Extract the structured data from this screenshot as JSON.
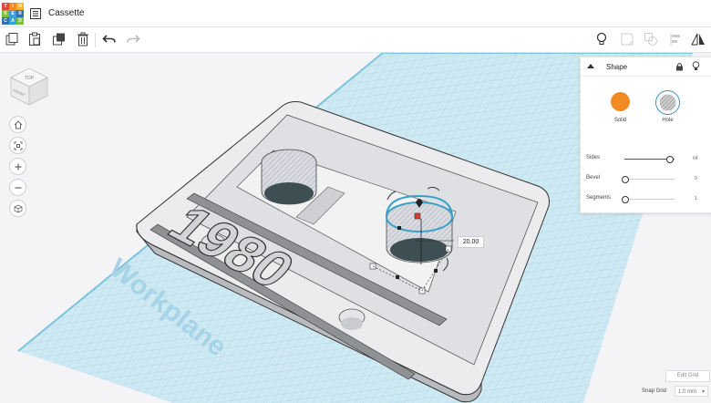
{
  "app": {
    "logo_letters": [
      "T",
      "I",
      "N",
      "K",
      "E",
      "R",
      "C",
      "A",
      "D"
    ],
    "title": "Cassette"
  },
  "toolbar": {
    "items": [
      "copy-icon",
      "paste-icon",
      "duplicate-icon",
      "delete-icon",
      "undo-icon",
      "redo-icon"
    ],
    "right_items": [
      "light-bulb-icon",
      "notes-icon",
      "group-icon",
      "align-icon",
      "mirror-icon"
    ]
  },
  "view_cube": {
    "top": "TOP",
    "front": "FRONT"
  },
  "nav_buttons": [
    "home-view",
    "fit-all",
    "zoom-in",
    "zoom-out",
    "ortho-view"
  ],
  "shape_panel": {
    "title": "Shape",
    "solid_label": "Solid",
    "hole_label": "Hole",
    "selected": "Hole",
    "colors": {
      "solid": "#f28a22"
    },
    "props": [
      {
        "label": "Sides",
        "value": "64",
        "fraction": 0.95
      },
      {
        "label": "Bevel",
        "value": "0",
        "fraction": 0.0
      },
      {
        "label": "Segments",
        "value": "1",
        "fraction": 0.0
      }
    ]
  },
  "scene": {
    "workplane_label": "Workplane",
    "dimension_value": "20.00",
    "text_3d": "1980"
  },
  "bottom": {
    "edit_grid": "Edit Grid",
    "snap_grid_label": "Snap Grid",
    "snap_grid_value": "1.0 mm"
  }
}
